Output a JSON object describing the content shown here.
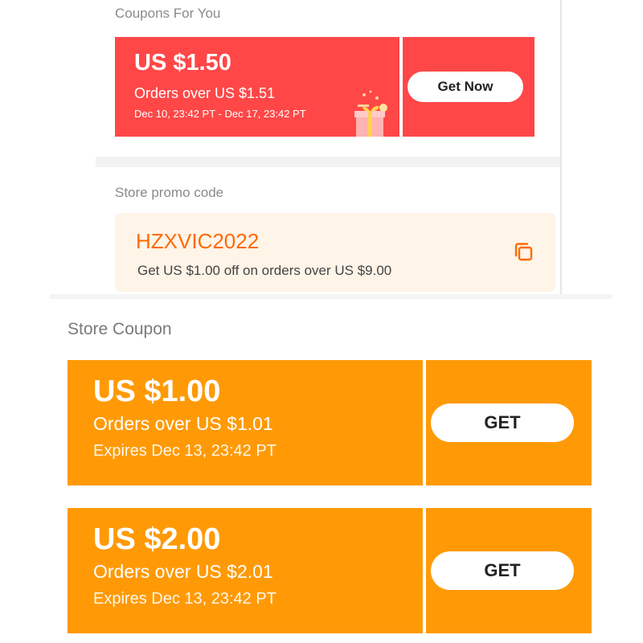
{
  "coupons_for_you": {
    "title": "Coupons For You",
    "coupon": {
      "amount": "US $1.50",
      "condition": "Orders over US $1.51",
      "validity": "Dec 10, 23:42 PT - Dec 17, 23:42 PT",
      "button_label": "Get Now",
      "color": "#ff4747",
      "icon": "gift-box-icon"
    }
  },
  "store_promo_code": {
    "title": "Store promo code",
    "code": "HZXVIC2022",
    "description": "Get US $1.00 off on orders over US $9.00",
    "code_color": "#ff6a00",
    "background": "#fff4e8",
    "icon": "copy-icon"
  },
  "store_coupon": {
    "title": "Store Coupon",
    "color": "#ff9a06",
    "coupons": [
      {
        "amount": "US $1.00",
        "condition": "Orders over US $1.01",
        "validity": "Expires Dec 13, 23:42 PT",
        "button_label": "GET"
      },
      {
        "amount": "US $2.00",
        "condition": "Orders over US $2.01",
        "validity": "Expires Dec 13, 23:42 PT",
        "button_label": "GET"
      }
    ]
  }
}
